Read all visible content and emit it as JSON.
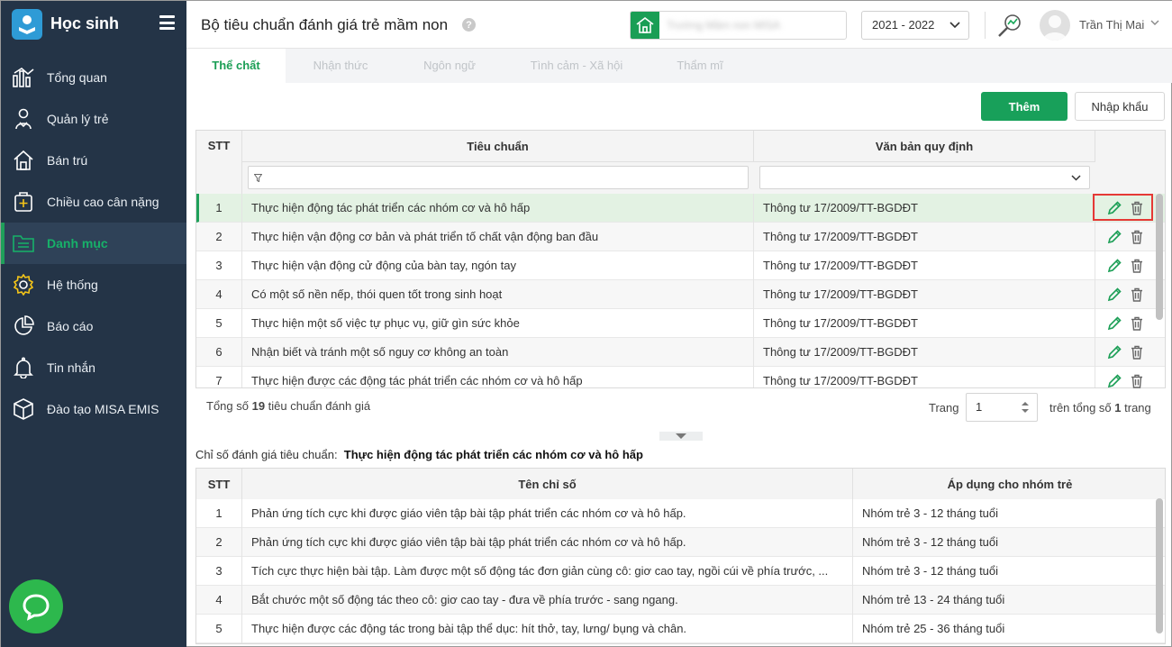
{
  "sidebar": {
    "app_name": "Học sinh",
    "items": [
      {
        "label": "Tổng quan",
        "icon": "chart-bars-icon"
      },
      {
        "label": "Quản lý trẻ",
        "icon": "student-icon"
      },
      {
        "label": "Bán trú",
        "icon": "home-icon"
      },
      {
        "label": "Chiều cao cân nặng",
        "icon": "health-plus-icon"
      },
      {
        "label": "Danh mục",
        "icon": "folder-list-icon",
        "active": true
      },
      {
        "label": "Hệ thống",
        "icon": "gear-icon"
      },
      {
        "label": "Báo cáo",
        "icon": "pie-chart-icon"
      },
      {
        "label": "Tin nhắn",
        "icon": "bell-icon"
      },
      {
        "label": "Đào tạo MISA EMIS",
        "icon": "cube-icon"
      }
    ]
  },
  "header": {
    "title": "Bộ tiêu chuẩn đánh giá trẻ mầm non",
    "help": "?",
    "school_name": "Trường Mầm non MISA",
    "school_year": "2021 - 2022",
    "user_name": "Trần Thị Mai"
  },
  "tabs": [
    "Thể chất",
    "Nhận thức",
    "Ngôn ngữ",
    "Tình cảm - Xã hội",
    "Thẩm mĩ"
  ],
  "actions": {
    "add": "Thêm",
    "import": "Nhập khẩu"
  },
  "standards_table": {
    "headers": {
      "no": "STT",
      "standard": "Tiêu chuẩn",
      "document": "Văn bản quy định"
    },
    "rows": [
      {
        "no": "1",
        "standard": "Thực hiện động tác phát triển các nhóm cơ và hô hấp",
        "document": "Thông tư 17/2009/TT-BGDĐT"
      },
      {
        "no": "2",
        "standard": "Thực hiện vận động cơ bản và phát triển tố chất vận động ban đầu",
        "document": "Thông tư 17/2009/TT-BGDĐT"
      },
      {
        "no": "3",
        "standard": "Thực hiện vận động cử động của bàn tay, ngón tay",
        "document": "Thông tư 17/2009/TT-BGDĐT"
      },
      {
        "no": "4",
        "standard": "Có một số nền nếp, thói quen tốt trong sinh hoạt",
        "document": "Thông tư 17/2009/TT-BGDĐT"
      },
      {
        "no": "5",
        "standard": "Thực hiện một số việc tự phục vụ, giữ gìn sức khỏe",
        "document": "Thông tư 17/2009/TT-BGDĐT"
      },
      {
        "no": "6",
        "standard": "Nhận biết và tránh một số nguy cơ không an toàn",
        "document": "Thông tư 17/2009/TT-BGDĐT"
      },
      {
        "no": "7",
        "standard": "Thực hiện được các động tác phát triển các nhóm cơ và hô hấp",
        "document": "Thông tư 17/2009/TT-BGDĐT"
      }
    ]
  },
  "pagination": {
    "total_prefix": "Tổng số ",
    "total_count": "19",
    "total_suffix": " tiêu chuẩn đánh giá",
    "page_label": "Trang",
    "page_value": "1",
    "of_prefix": "trên tổng số ",
    "of_count": "1",
    "of_suffix": " trang"
  },
  "criteria": {
    "label": "Chỉ số đánh giá tiêu chuẩn:",
    "selected": "Thực hiện động tác phát triển các nhóm cơ và hô hấp"
  },
  "indicators_table": {
    "headers": {
      "no": "STT",
      "name": "Tên chỉ số",
      "group": "Áp dụng cho nhóm trẻ"
    },
    "rows": [
      {
        "no": "1",
        "name": "Phản ứng tích cực khi được giáo viên tập bài tập phát triển các nhóm cơ và hô hấp.",
        "group": "Nhóm trẻ 3 - 12 tháng tuổi"
      },
      {
        "no": "2",
        "name": "Phản ứng tích cực khi được giáo viên tập bài tập phát triển các nhóm cơ và hô hấp.",
        "group": "Nhóm trẻ 3 - 12 tháng tuổi"
      },
      {
        "no": "3",
        "name": "Tích cực thực hiện bài tập. Làm được một số động tác đơn giản cùng cô: giơ cao tay, ngồi cúi về phía trước, ...",
        "group": "Nhóm trẻ 3 - 12 tháng tuổi"
      },
      {
        "no": "4",
        "name": "Bắt chước một số động tác theo cô: giơ cao tay - đưa về phía trước - sang ngang.",
        "group": "Nhóm trẻ 13 - 24 tháng tuổi"
      },
      {
        "no": "5",
        "name": "Thực hiện được các động tác trong bài tập thể dục: hít thở, tay, lưng/ bụng và chân.",
        "group": "Nhóm trẻ 25 - 36 tháng tuổi"
      }
    ]
  },
  "colors": {
    "sidebar_bg": "#243447",
    "accent": "#18a05a",
    "highlight": "#e53935"
  }
}
